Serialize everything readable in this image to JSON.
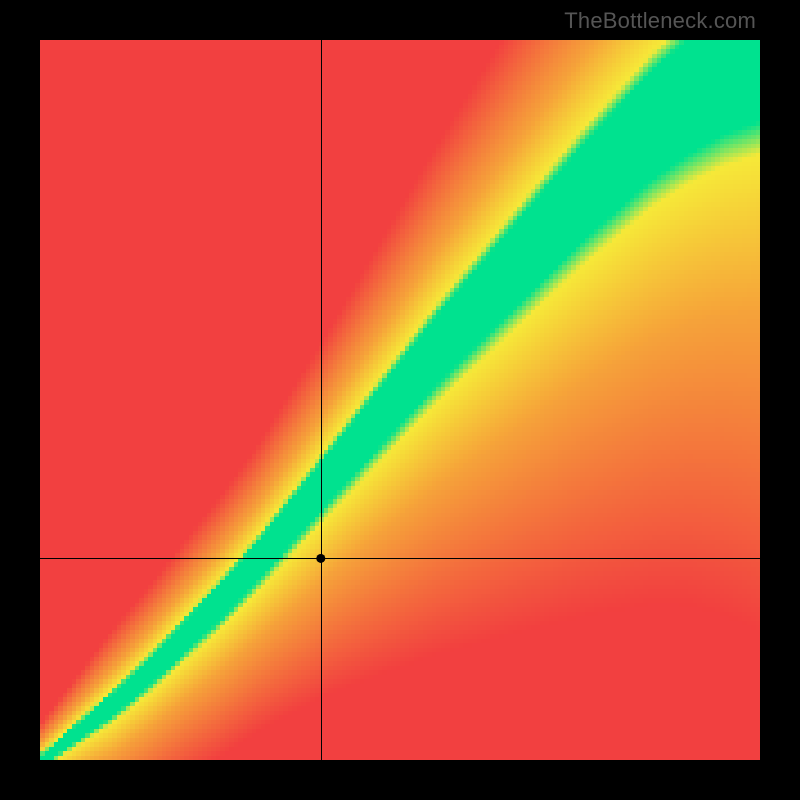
{
  "watermark": "TheBottleneck.com",
  "chart_data": {
    "type": "heatmap",
    "title": "",
    "xlabel": "",
    "ylabel": "",
    "xlim": [
      0,
      1
    ],
    "ylim": [
      0,
      1
    ],
    "grid_size": 160,
    "crosshair": {
      "x": 0.39,
      "y": 0.28
    },
    "marker": {
      "x": 0.39,
      "y": 0.28
    },
    "ideal_curve": {
      "description": "green ridge y = f(x) for matched components",
      "samples_x": [
        0.0,
        0.05,
        0.1,
        0.15,
        0.2,
        0.25,
        0.3,
        0.35,
        0.4,
        0.45,
        0.5,
        0.55,
        0.6,
        0.65,
        0.7,
        0.75,
        0.8,
        0.85,
        0.9,
        0.95,
        1.0
      ],
      "samples_y": [
        0.0,
        0.04,
        0.08,
        0.125,
        0.175,
        0.225,
        0.28,
        0.34,
        0.4,
        0.46,
        0.52,
        0.58,
        0.635,
        0.69,
        0.745,
        0.8,
        0.85,
        0.9,
        0.94,
        0.975,
        1.0
      ]
    },
    "band_halfwidth": {
      "samples_x": [
        0.0,
        0.1,
        0.2,
        0.3,
        0.4,
        0.5,
        0.6,
        0.7,
        0.8,
        0.9,
        1.0
      ],
      "samples_y": [
        0.01,
        0.02,
        0.025,
        0.03,
        0.038,
        0.048,
        0.058,
        0.068,
        0.078,
        0.088,
        0.1
      ]
    },
    "color_stops": {
      "green": "#00e28f",
      "yellow": "#f7e938",
      "orange": "#f6a33a",
      "red": "#f24040"
    }
  }
}
